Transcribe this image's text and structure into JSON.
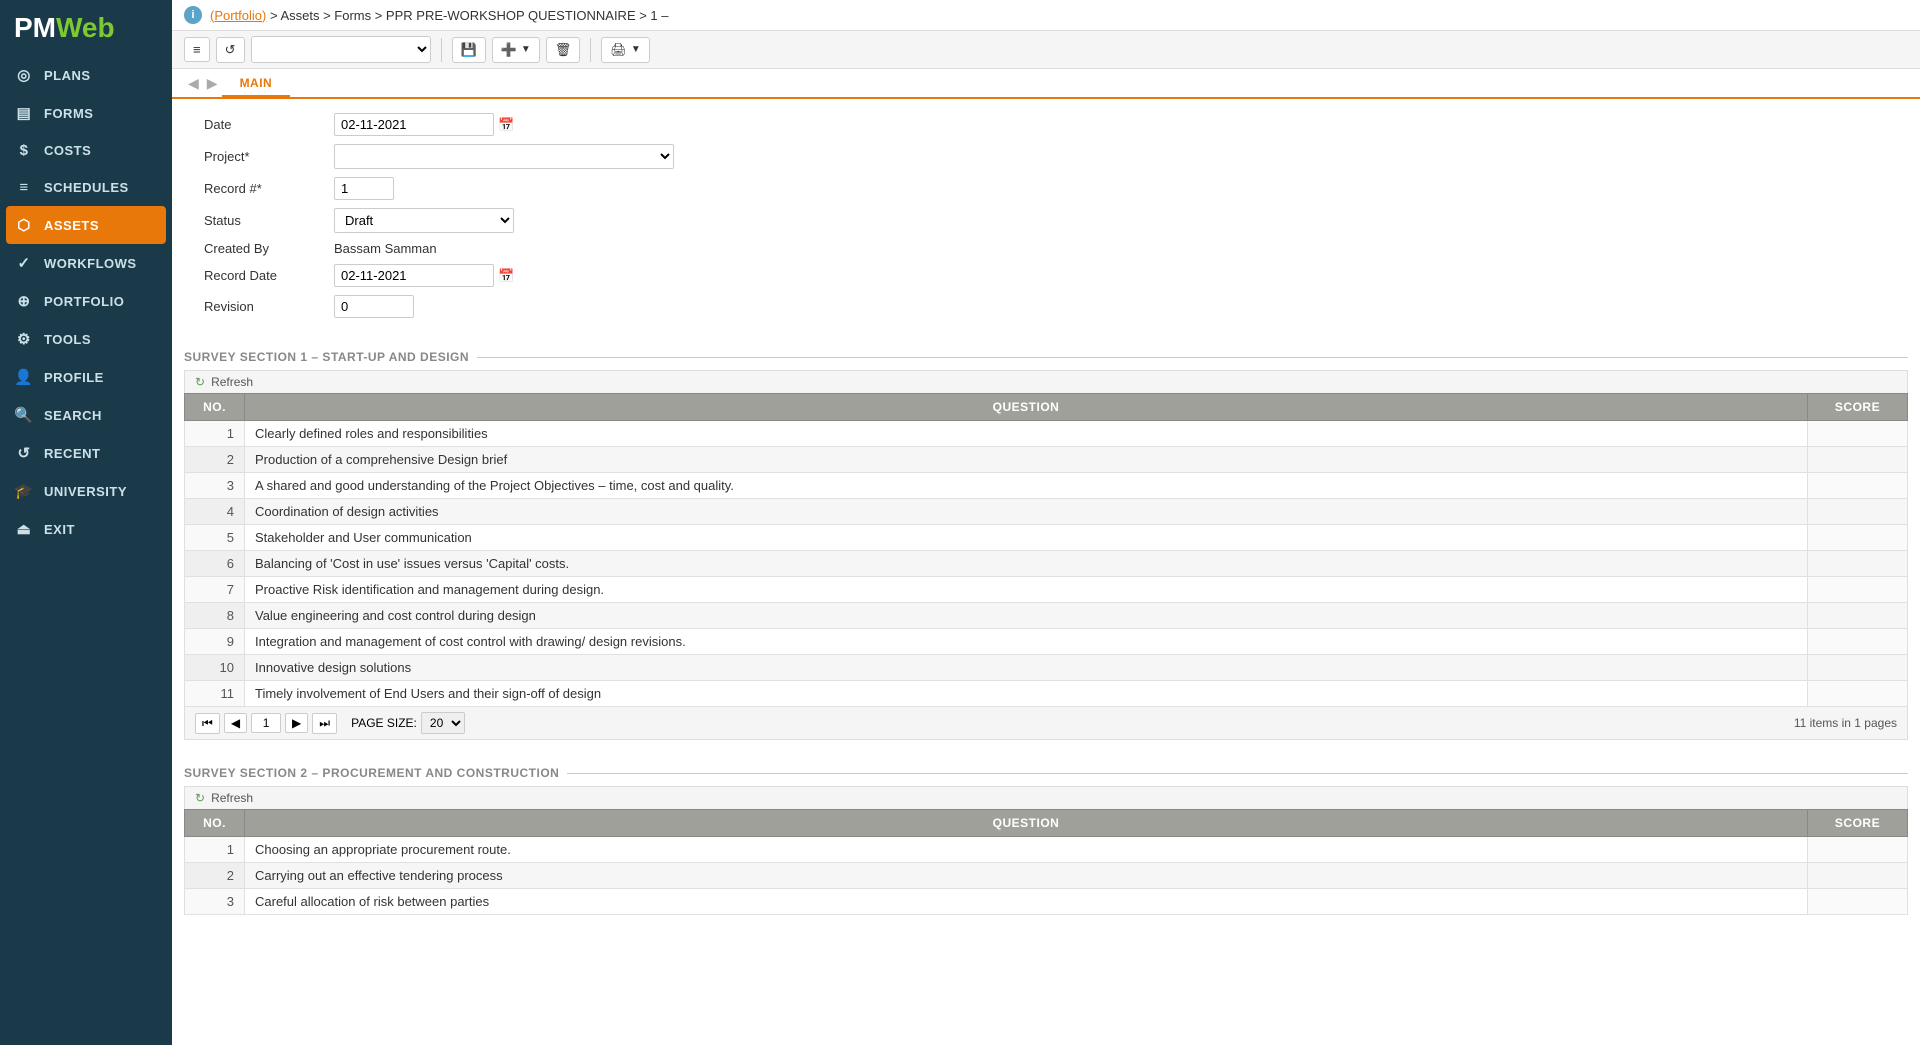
{
  "sidebar": {
    "logo": "PMWeb",
    "items": [
      {
        "id": "plans",
        "label": "PLANS",
        "icon": "◎"
      },
      {
        "id": "forms",
        "label": "FORMS",
        "icon": "▤"
      },
      {
        "id": "costs",
        "label": "COSTS",
        "icon": "$"
      },
      {
        "id": "schedules",
        "label": "SCHEDULES",
        "icon": "≡"
      },
      {
        "id": "assets",
        "label": "ASSETS",
        "icon": "⬡",
        "active": true
      },
      {
        "id": "workflows",
        "label": "WORKFLOWS",
        "icon": "✓"
      },
      {
        "id": "portfolio",
        "label": "PORTFOLIO",
        "icon": "⊕"
      },
      {
        "id": "tools",
        "label": "TOOLS",
        "icon": "⚙"
      },
      {
        "id": "profile",
        "label": "PROFILE",
        "icon": "👤"
      },
      {
        "id": "search",
        "label": "SEARCH",
        "icon": "🔍"
      },
      {
        "id": "recent",
        "label": "RECENT",
        "icon": "↺"
      },
      {
        "id": "university",
        "label": "UNIVERSITY",
        "icon": "🎓"
      },
      {
        "id": "exit",
        "label": "EXIT",
        "icon": "⏏"
      }
    ]
  },
  "breadcrumb": {
    "portfolio": "(Portfolio)",
    "path": " > Assets > Forms > PPR PRE-WORKSHOP QUESTIONNAIRE > 1 –"
  },
  "toolbar": {
    "menu_icon": "≡",
    "undo_icon": "↺",
    "dropdown_placeholder": "",
    "save_label": "💾",
    "add_label": "➕",
    "delete_label": "🗑",
    "print_label": "🖨"
  },
  "tab": {
    "label": "MAIN"
  },
  "form": {
    "date_label": "Date",
    "date_value": "02-11-2021",
    "project_label": "Project*",
    "project_value": "",
    "record_label": "Record #*",
    "record_value": "1",
    "status_label": "Status",
    "status_value": "Draft",
    "created_by_label": "Created By",
    "created_by_value": "Bassam Samman",
    "record_date_label": "Record Date",
    "record_date_value": "02-11-2021",
    "revision_label": "Revision",
    "revision_value": "0"
  },
  "survey1": {
    "section_title": "SURVEY SECTION 1 – START-UP AND DESIGN",
    "refresh_label": "Refresh",
    "columns": {
      "no": "NO.",
      "question": "QUESTION",
      "score": "SCORE"
    },
    "rows": [
      {
        "no": 1,
        "question": "Clearly defined roles and responsibilities"
      },
      {
        "no": 2,
        "question": "Production of a comprehensive Design brief"
      },
      {
        "no": 3,
        "question": "A shared and good understanding of the Project Objectives – time, cost and quality."
      },
      {
        "no": 4,
        "question": "Coordination of design activities"
      },
      {
        "no": 5,
        "question": "Stakeholder and User communication"
      },
      {
        "no": 6,
        "question": "Balancing of 'Cost in use' issues versus 'Capital' costs."
      },
      {
        "no": 7,
        "question": "Proactive Risk identification and management during design."
      },
      {
        "no": 8,
        "question": "Value engineering and cost control during design"
      },
      {
        "no": 9,
        "question": "Integration and management of cost control with drawing/ design revisions."
      },
      {
        "no": 10,
        "question": "Innovative design solutions"
      },
      {
        "no": 11,
        "question": "Timely involvement of End Users and their sign-off of design"
      }
    ],
    "pagination": {
      "current_page": "1",
      "page_size": "20",
      "total_items": "11 items in 1 pages"
    }
  },
  "survey2": {
    "section_title": "SURVEY SECTION 2 – PROCUREMENT AND CONSTRUCTION",
    "refresh_label": "Refresh",
    "columns": {
      "no": "NO.",
      "question": "QUESTION",
      "score": "SCORE"
    },
    "rows": [
      {
        "no": 1,
        "question": "Choosing an appropriate procurement route."
      },
      {
        "no": 2,
        "question": "Carrying out an effective tendering process"
      },
      {
        "no": 3,
        "question": "Careful allocation of risk between parties"
      }
    ]
  }
}
